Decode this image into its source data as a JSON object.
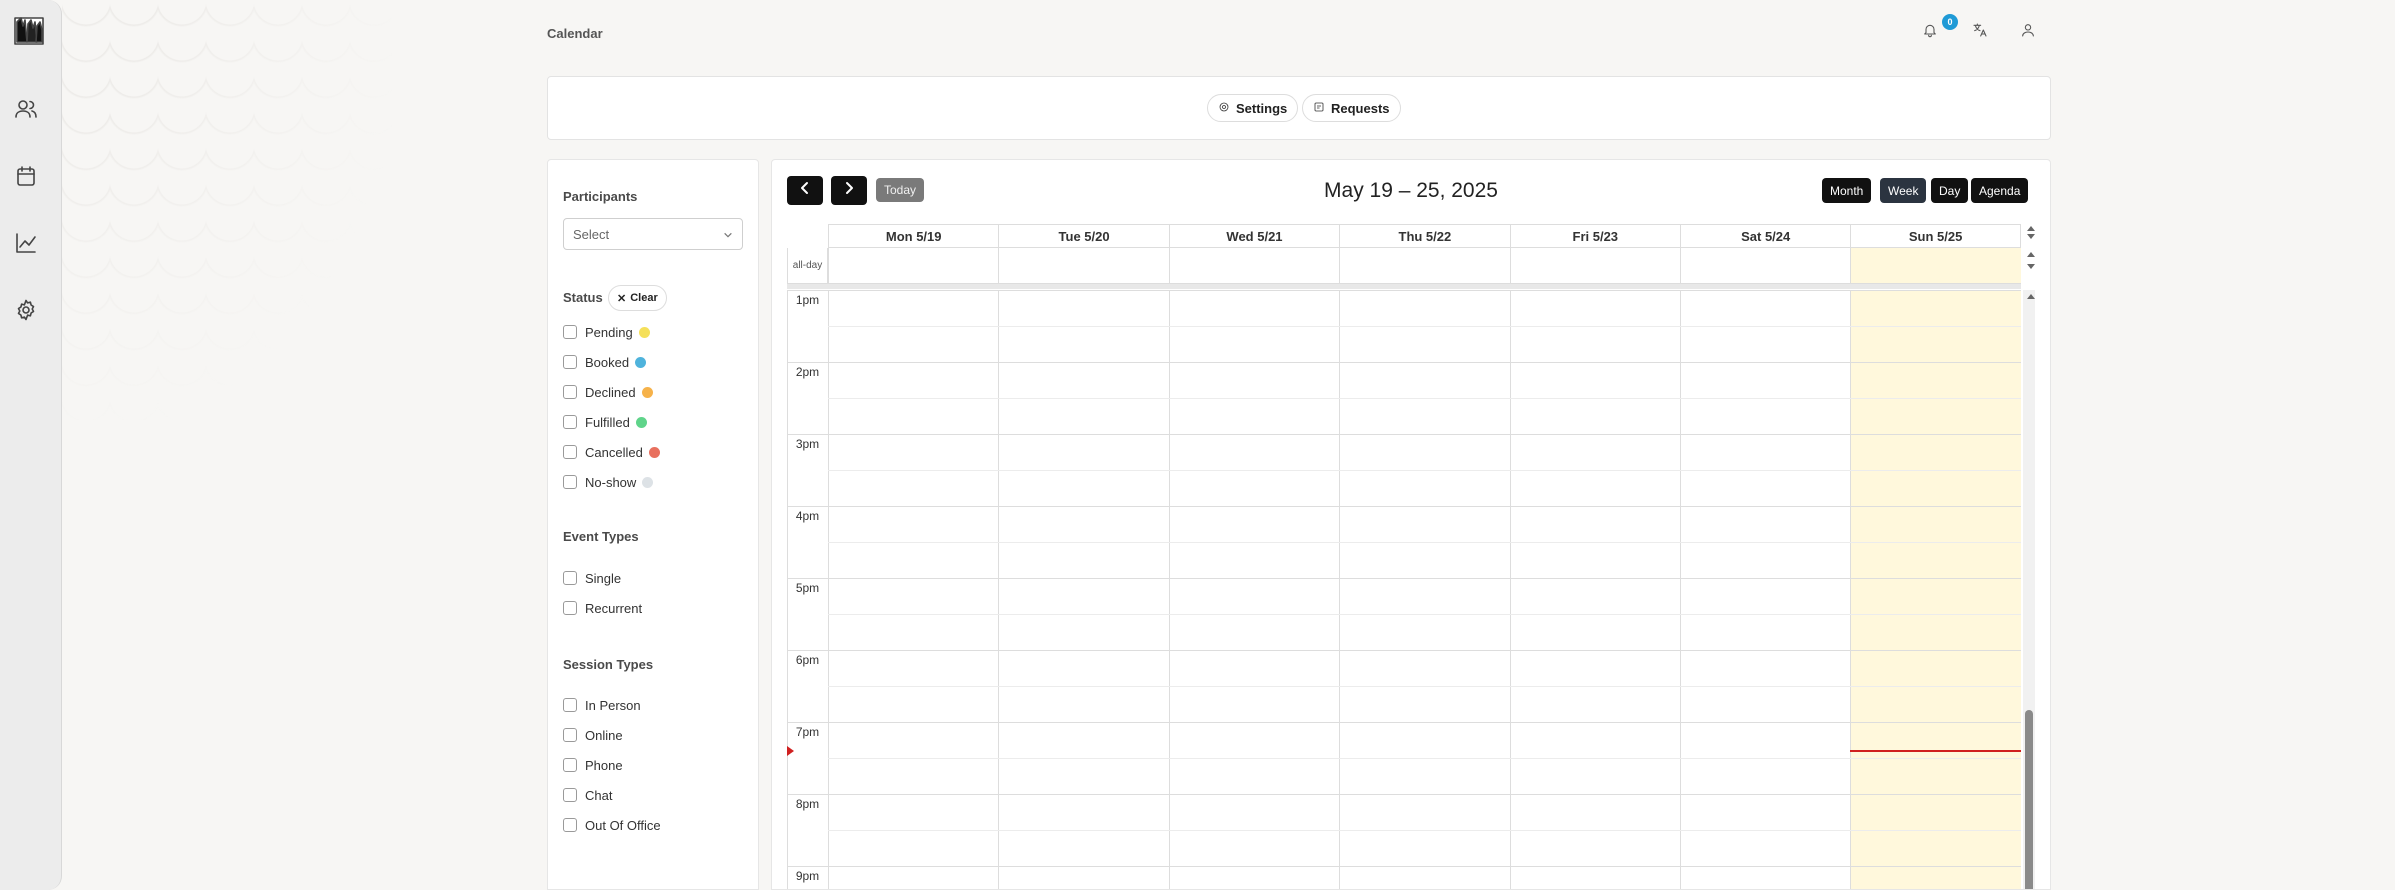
{
  "app": {
    "page_title": "Calendar",
    "notification_count": "0"
  },
  "nav": {
    "icons": [
      "users-icon",
      "calendar-icon",
      "chart-icon",
      "gear-icon"
    ]
  },
  "top_panel": {
    "settings_label": "Settings",
    "requests_label": "Requests"
  },
  "filters": {
    "participants_label": "Participants",
    "participants_placeholder": "Select",
    "status_label": "Status",
    "clear_label": "Clear",
    "statuses": [
      {
        "label": "Pending",
        "color": "#f5e05a"
      },
      {
        "label": "Booked",
        "color": "#4fb3dc"
      },
      {
        "label": "Declined",
        "color": "#f6b24a"
      },
      {
        "label": "Fulfilled",
        "color": "#5fd48a"
      },
      {
        "label": "Cancelled",
        "color": "#e8705e"
      },
      {
        "label": "No-show",
        "color": "#dde2e6"
      }
    ],
    "event_types_label": "Event Types",
    "event_types": [
      "Single",
      "Recurrent"
    ],
    "session_types_label": "Session Types",
    "session_types": [
      "In Person",
      "Online",
      "Phone",
      "Chat",
      "Out Of Office"
    ]
  },
  "calendar": {
    "title": "May 19 – 25, 2025",
    "today_label": "Today",
    "views": [
      "Month",
      "Week",
      "Day",
      "Agenda"
    ],
    "active_view": "Week",
    "all_day_label": "all-day",
    "days": [
      "Mon 5/19",
      "Tue 5/20",
      "Wed 5/21",
      "Thu 5/22",
      "Fri 5/23",
      "Sat 5/24",
      "Sun 5/25"
    ],
    "today_index": 6,
    "hours": [
      "1pm",
      "2pm",
      "3pm",
      "4pm",
      "5pm",
      "6pm",
      "7pm",
      "8pm",
      "9pm"
    ],
    "now_time": "7:23pm",
    "colors": {
      "today_bg": "#fff8dc",
      "now_line": "#d02020"
    }
  }
}
